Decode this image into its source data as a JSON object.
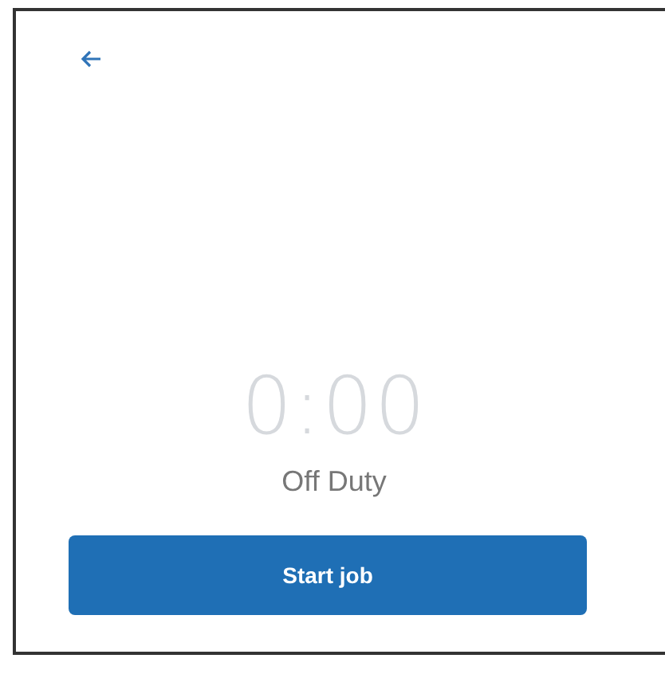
{
  "timer": {
    "value": "0:00",
    "status": "Off Duty"
  },
  "button": {
    "label": "Start job"
  }
}
